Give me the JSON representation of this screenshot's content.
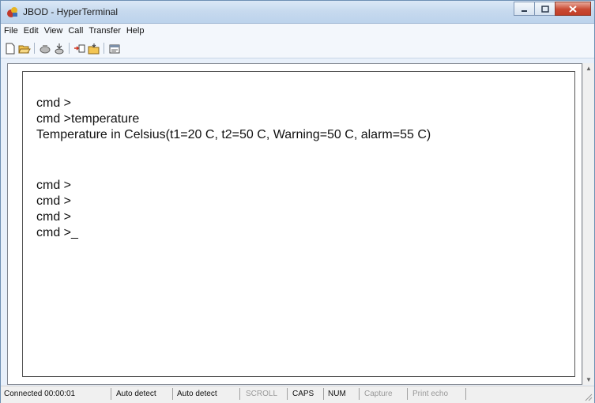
{
  "window": {
    "title": "JBOD - HyperTerminal"
  },
  "menu": [
    "File",
    "Edit",
    "View",
    "Call",
    "Transfer",
    "Help"
  ],
  "toolbar_icons": [
    "new-icon",
    "open-icon",
    "call-icon",
    "disconnect-icon",
    "send-icon",
    "receive-icon",
    "properties-icon"
  ],
  "terminal": {
    "lines": [
      "cmd >",
      "cmd >temperature",
      "Temperature in Celsius(t1=20 C, t2=50 C, Warning=50 C, alarm=55 C)",
      "",
      "",
      "cmd >",
      "cmd >",
      "cmd >",
      "cmd >_"
    ]
  },
  "status": {
    "connected": "Connected 00:00:01",
    "detect1": "Auto detect",
    "detect2": "Auto detect",
    "scroll": "SCROLL",
    "caps": "CAPS",
    "num": "NUM",
    "capture": "Capture",
    "print_echo": "Print echo"
  },
  "colors": {
    "close_button": "#c94a33",
    "title_gradient": "#c6d9ee"
  }
}
